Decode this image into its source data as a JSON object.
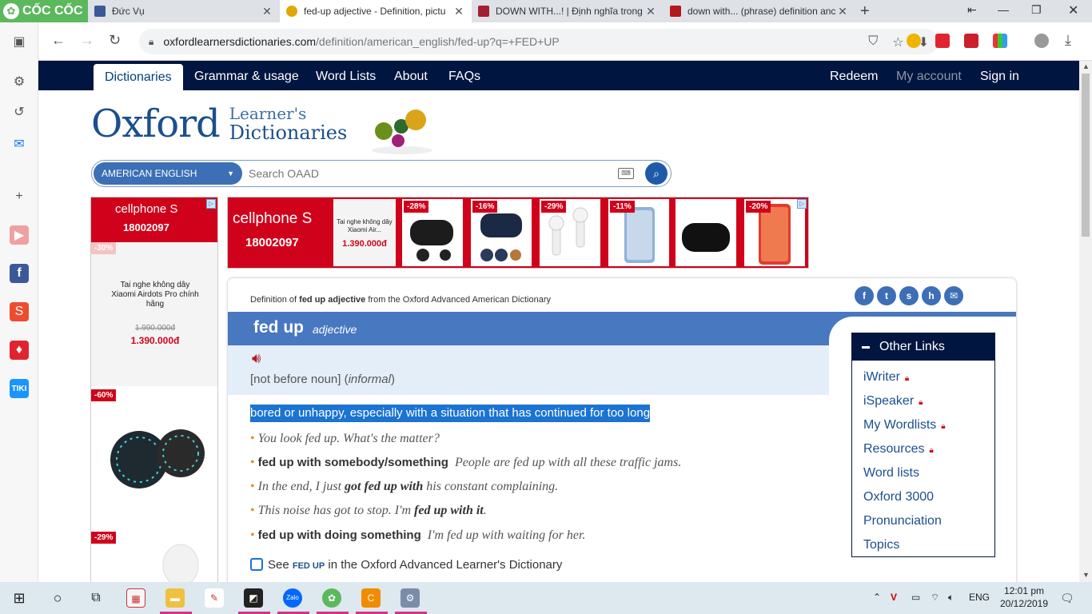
{
  "browser": {
    "brand": "CỐC CỐC",
    "tabs": [
      {
        "title": "Đức Vụ"
      },
      {
        "title": "fed-up adjective - Definition, pictu"
      },
      {
        "title": "DOWN WITH...! | Định nghĩa trong"
      },
      {
        "title": "down with... (phrase) definition anc"
      }
    ],
    "url_host": "oxfordlearnersdictionaries.com",
    "url_path": "/definition/american_english/fed-up?q=+FED+UP"
  },
  "nav": {
    "items": [
      "Dictionaries",
      "Grammar & usage",
      "Word Lists",
      "About",
      "FAQs"
    ],
    "right": [
      "Redeem",
      "My account",
      "Sign in"
    ]
  },
  "logo": {
    "main": "Oxford",
    "line1": "Learner's",
    "line2": "Dictionaries"
  },
  "search": {
    "dictionary": "AMERICAN ENGLISH",
    "placeholder": "Search OAAD"
  },
  "ads": {
    "brand": "cellphone S",
    "phone": "18002097",
    "left_discounts": [
      "-30%",
      "-60%",
      "-29%"
    ],
    "left_product_name": "Tai nghe không dây Xiaomi Airdots Pro chính hãng",
    "left_old_price": "1.990.000đ",
    "left_price": "1.390.000đ",
    "top_product_name": "Tai nghe không dây Xiaomi Air...",
    "top_price": "1.390.000đ",
    "top_discounts": [
      "-28%",
      "-16%",
      "-29%",
      "-11%",
      "",
      "-20%"
    ]
  },
  "entry": {
    "def_prefix": "Definition of ",
    "def_word": "fed up adjective",
    "def_suffix": " from the Oxford Advanced American Dictionary",
    "headword": "fed up",
    "pos": "adjective",
    "grammar": "[not before noun] (",
    "register": "informal",
    "grammar_end": ")",
    "definition": "bored or unhappy, especially with a situation that has continued for too long",
    "ex1": "You look fed up. What's the matter?",
    "cf1": "fed up with somebody/something",
    "ex2": "People are fed up with all these traffic jams.",
    "ex3_pre": "In the end, I just ",
    "ex3_bold": "got fed up with",
    "ex3_post": " his constant complaining.",
    "ex4_pre": "This noise has got to stop. I'm ",
    "ex4_bold": "fed up with it",
    "ex4_post": ".",
    "cf2": "fed up with doing something",
    "ex5": "I'm fed up with waiting for her.",
    "see_pre": "See ",
    "see_word": "FED UP",
    "see_post": " in the Oxford Advanced Learner's Dictionary"
  },
  "other_links": {
    "title": "Other Links",
    "items": [
      "iWriter",
      "iSpeaker",
      "My Wordlists",
      "Resources",
      "Word lists",
      "Oxford 3000",
      "Pronunciation",
      "Topics"
    ]
  },
  "taskbar": {
    "lang": "ENG",
    "time": "12:01 pm",
    "date": "20/12/2019"
  },
  "colors": {
    "nav": "#001540",
    "accent": "#4878c0",
    "highlight": "#1b73d2",
    "ad_red": "#d0021b"
  }
}
